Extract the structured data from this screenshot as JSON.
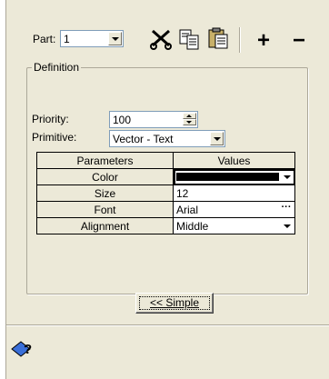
{
  "toolbar": {
    "part_label": "Part:",
    "part_value": "1",
    "add_label": "+",
    "remove_label": "−",
    "icons": [
      "scissors-icon",
      "copy-icon",
      "paste-icon"
    ]
  },
  "definition": {
    "legend": "Definition",
    "priority_label": "Priority:",
    "priority_value": "100",
    "primitive_label": "Primitive:",
    "primitive_value": "Vector - Text"
  },
  "grid": {
    "headers": [
      "Parameters",
      "Values"
    ],
    "rows": [
      {
        "name": "Color",
        "value": "",
        "swatch": "#000000"
      },
      {
        "name": "Size",
        "value": "12"
      },
      {
        "name": "Font",
        "value": "Arial"
      },
      {
        "name": "Alignment",
        "value": "Middle"
      }
    ]
  },
  "simple_button": "<< Simple",
  "help_icon": "help-question-icon"
}
